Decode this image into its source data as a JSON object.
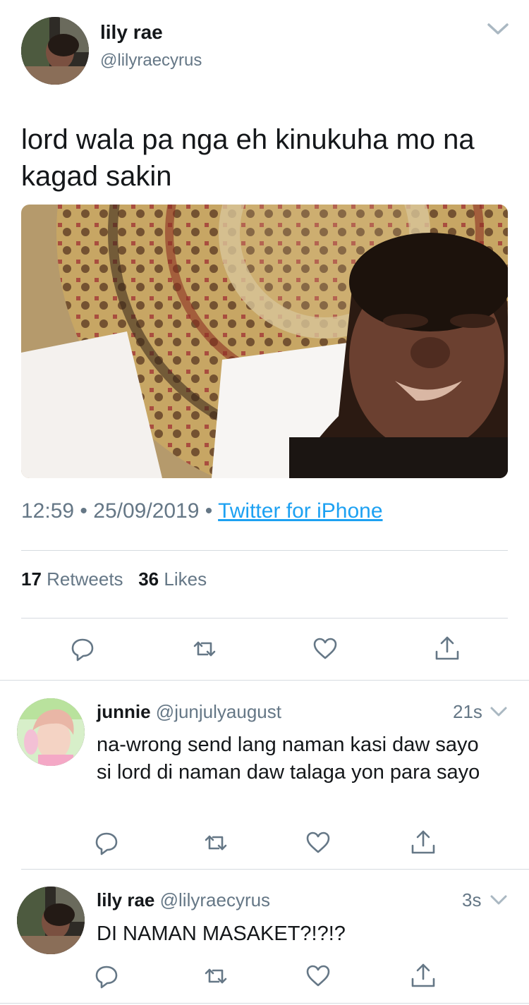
{
  "tweet": {
    "name": "lily rae",
    "handle": "@lilyraecyrus",
    "text": "lord wala pa nga eh kinukuha mo na kagad sakin",
    "time": "12:59",
    "date": "25/09/2019",
    "source": "Twitter for iPhone",
    "retweets_count": "17",
    "retweets_label": "Retweets",
    "likes_count": "36",
    "likes_label": "Likes"
  },
  "replies": [
    {
      "name": "junnie",
      "handle": "@junjulyaugust",
      "time": "21s",
      "text": "na-wrong send lang naman kasi daw sayo si lord di naman daw talaga yon para sayo"
    },
    {
      "name": "lily rae",
      "handle": "@lilyraecyrus",
      "time": "3s",
      "text": "DI NAMAN MASAKET?!?!?"
    }
  ],
  "separator": "•",
  "icons": {
    "reply": "reply-icon",
    "retweet": "retweet-icon",
    "like": "heart-icon",
    "share": "share-icon",
    "menu": "chevron-down-icon"
  },
  "colors": {
    "link": "#1da1f2",
    "secondary_text": "#657786",
    "divider": "#d6dbe0"
  }
}
